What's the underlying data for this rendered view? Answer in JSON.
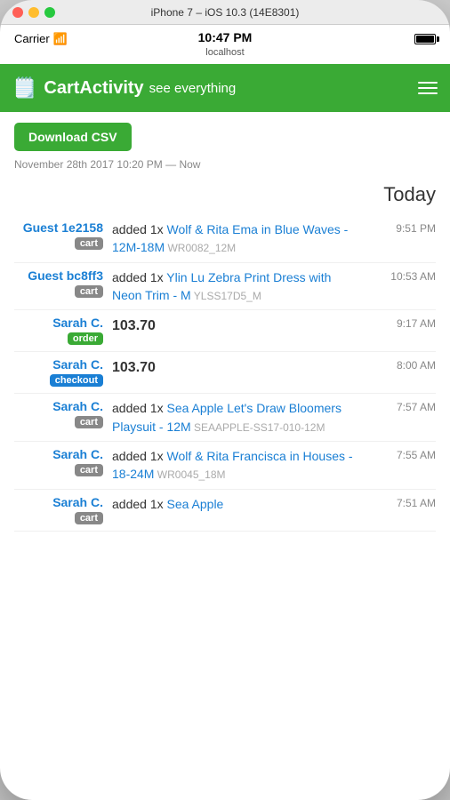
{
  "device": {
    "title": "iPhone 7 – iOS 10.3 (14E8301)",
    "carrier": "Carrier",
    "time": "10:47 PM",
    "location": "localhost"
  },
  "nav": {
    "logo": "🗒️",
    "title": "CartActivity",
    "subtitle": "see everything",
    "menu_icon": "hamburger"
  },
  "toolbar": {
    "download_btn": "Download CSV",
    "date_range": "November 28th 2017 10:20 PM — Now"
  },
  "section": {
    "label": "Today"
  },
  "activities": [
    {
      "actor": "Guest 1e2158",
      "badge": "cart",
      "badge_type": "cart",
      "time": "9:51 PM",
      "description": "added 1x",
      "product": "Wolf & Rita Ema in Blue Waves - 12M-18M",
      "sku": "WR0082_12M"
    },
    {
      "actor": "Guest bc8ff3",
      "badge": "cart",
      "badge_type": "cart",
      "time": "10:53 AM",
      "description": "added 1x",
      "product": "Ylin Lu Zebra Print Dress with Neon Trim - M",
      "sku": "YLSS17D5_M"
    },
    {
      "actor": "Sarah C.",
      "badge": "order",
      "badge_type": "order",
      "time": "9:17 AM",
      "description": "",
      "product": "",
      "sku": "",
      "amount": "103.70"
    },
    {
      "actor": "Sarah C.",
      "badge": "checkout",
      "badge_type": "checkout",
      "time": "8:00 AM",
      "description": "",
      "product": "",
      "sku": "",
      "amount": "103.70"
    },
    {
      "actor": "Sarah C.",
      "badge": "cart",
      "badge_type": "cart",
      "time": "7:57 AM",
      "description": "added 1x",
      "product": "Sea Apple Let's Draw Bloomers Playsuit - 12M",
      "sku": "SEAAPPLE-SS17-010-12M"
    },
    {
      "actor": "Sarah C.",
      "badge": "cart",
      "badge_type": "cart",
      "time": "7:55 AM",
      "description": "added 1x",
      "product": "Wolf & Rita Francisca in Houses - 18-24M",
      "sku": "WR0045_18M"
    },
    {
      "actor": "Sarah C.",
      "badge": "cart",
      "badge_type": "cart",
      "time": "7:51 AM",
      "description": "added 1x",
      "product": "Sea Apple",
      "sku": ""
    }
  ]
}
